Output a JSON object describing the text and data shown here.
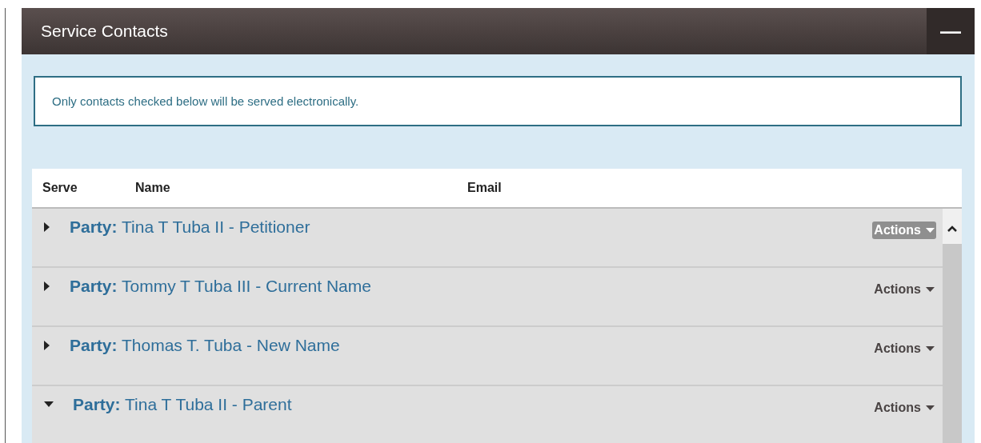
{
  "panel": {
    "title": "Service Contacts",
    "collapse_icon": "—"
  },
  "notice": "Only contacts checked below will be served electronically.",
  "table": {
    "columns": [
      "Serve",
      "Name",
      "Email"
    ],
    "rows": [
      {
        "label": "Party:",
        "name": "Tina T Tuba II - Petitioner",
        "expanded": false,
        "actions": "Actions",
        "highlighted": true
      },
      {
        "label": "Party:",
        "name": "Tommy T Tuba III - Current Name",
        "expanded": false,
        "actions": "Actions",
        "highlighted": false
      },
      {
        "label": "Party:",
        "name": "Thomas T. Tuba - New Name",
        "expanded": false,
        "actions": "Actions",
        "highlighted": false
      },
      {
        "label": "Party:",
        "name": "Tina T Tuba II - Parent",
        "expanded": true,
        "actions": "Actions",
        "highlighted": false
      }
    ]
  }
}
